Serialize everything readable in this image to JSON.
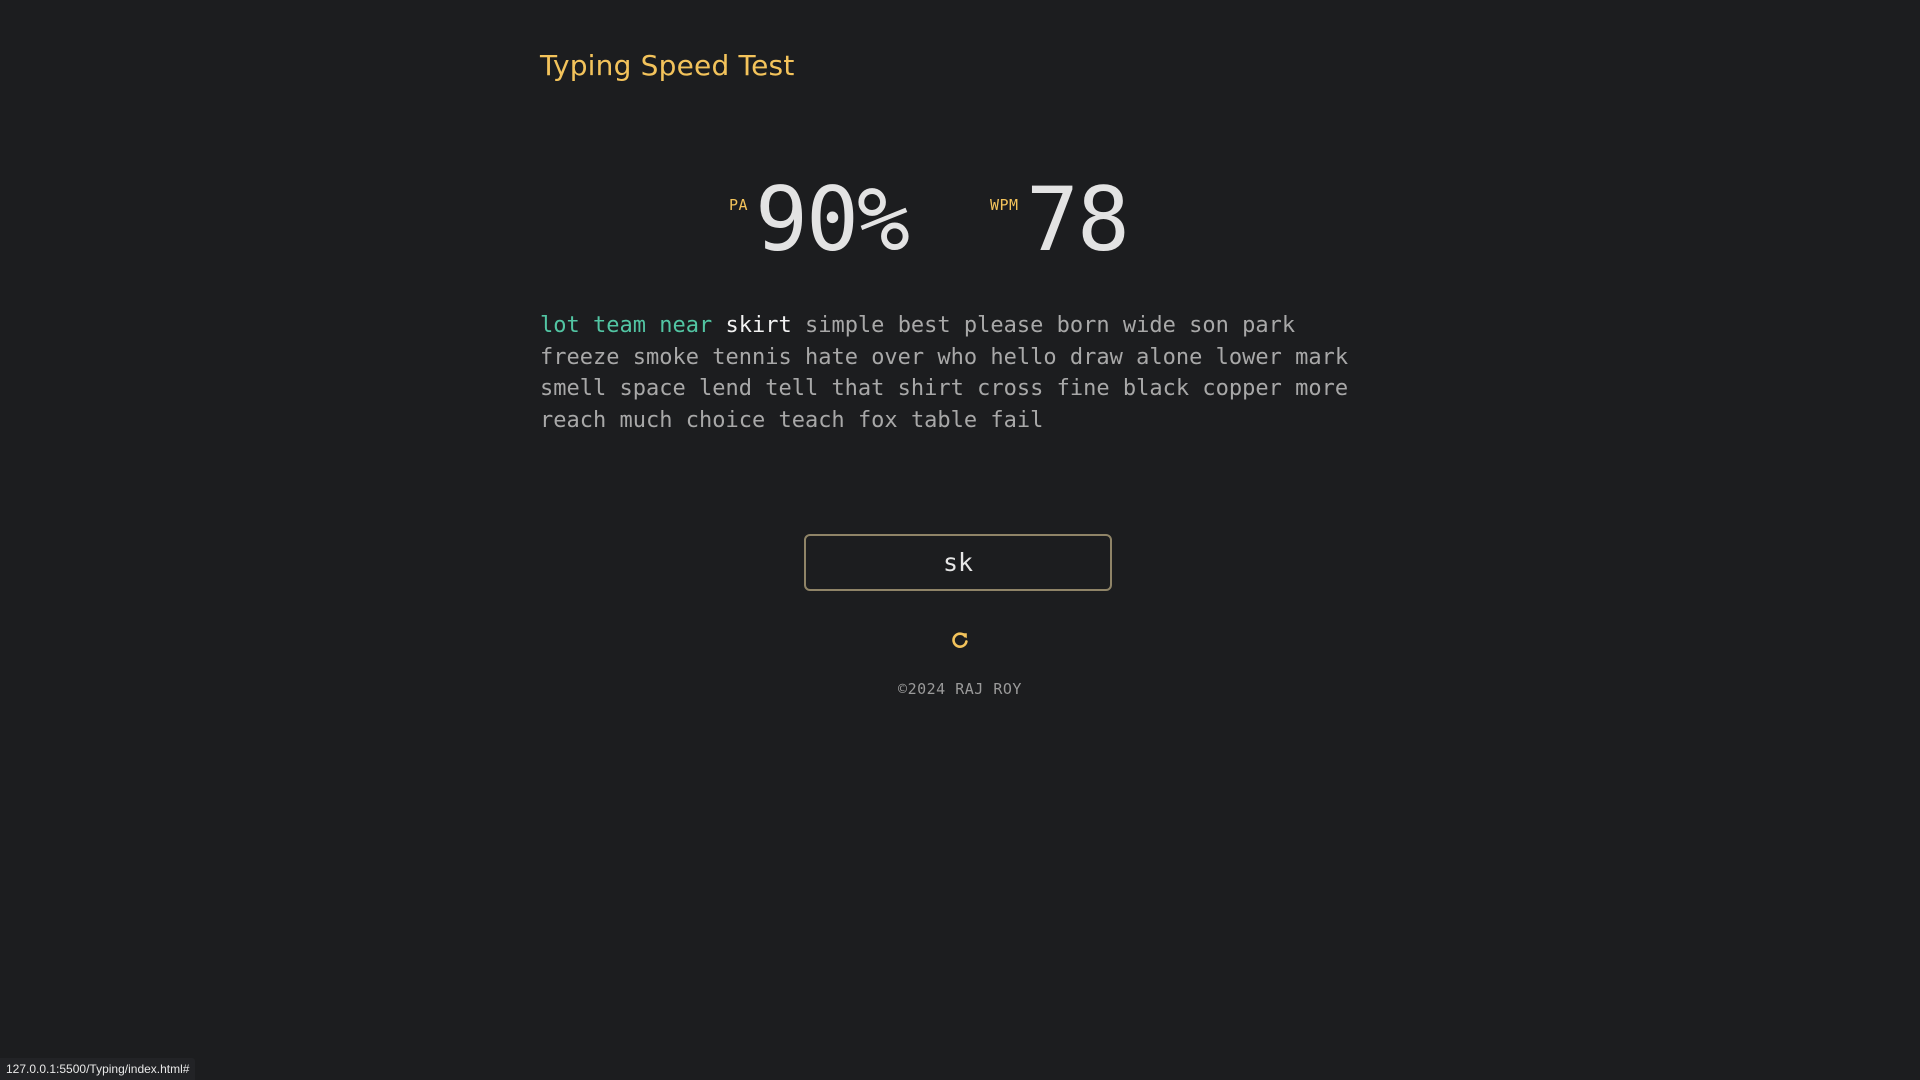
{
  "app": {
    "title": "Typing Speed Test",
    "accent_color": "#f3c35b",
    "correct_color": "#52c5a3",
    "background_color": "#1c1d1f"
  },
  "stats": {
    "accuracy_label": "PA",
    "accuracy_value": "90%",
    "wpm_label": "WPM",
    "wpm_value": "78"
  },
  "words": [
    {
      "text": "lot",
      "state": "correct"
    },
    {
      "text": "team",
      "state": "correct"
    },
    {
      "text": "near",
      "state": "correct"
    },
    {
      "text": "skirt",
      "state": "current"
    },
    {
      "text": "simple",
      "state": "pending"
    },
    {
      "text": "best",
      "state": "pending"
    },
    {
      "text": "please",
      "state": "pending"
    },
    {
      "text": "born",
      "state": "pending"
    },
    {
      "text": "wide",
      "state": "pending"
    },
    {
      "text": "son",
      "state": "pending"
    },
    {
      "text": "park",
      "state": "pending"
    },
    {
      "text": "freeze",
      "state": "pending"
    },
    {
      "text": "smoke",
      "state": "pending"
    },
    {
      "text": "tennis",
      "state": "pending"
    },
    {
      "text": "hate",
      "state": "pending"
    },
    {
      "text": "over",
      "state": "pending"
    },
    {
      "text": "who",
      "state": "pending"
    },
    {
      "text": "hello",
      "state": "pending"
    },
    {
      "text": "draw",
      "state": "pending"
    },
    {
      "text": "alone",
      "state": "pending"
    },
    {
      "text": "lower",
      "state": "pending"
    },
    {
      "text": "mark",
      "state": "pending"
    },
    {
      "text": "smell",
      "state": "pending"
    },
    {
      "text": "space",
      "state": "pending"
    },
    {
      "text": "lend",
      "state": "pending"
    },
    {
      "text": "tell",
      "state": "pending"
    },
    {
      "text": "that",
      "state": "pending"
    },
    {
      "text": "shirt",
      "state": "pending"
    },
    {
      "text": "cross",
      "state": "pending"
    },
    {
      "text": "fine",
      "state": "pending"
    },
    {
      "text": "black",
      "state": "pending"
    },
    {
      "text": "copper",
      "state": "pending"
    },
    {
      "text": "more",
      "state": "pending"
    },
    {
      "text": "reach",
      "state": "pending"
    },
    {
      "text": "much",
      "state": "pending"
    },
    {
      "text": "choice",
      "state": "pending"
    },
    {
      "text": "teach",
      "state": "pending"
    },
    {
      "text": "fox",
      "state": "pending"
    },
    {
      "text": "table",
      "state": "pending"
    },
    {
      "text": "fail",
      "state": "pending"
    }
  ],
  "input": {
    "value": "sk"
  },
  "reset": {
    "icon": "refresh-icon"
  },
  "footer": {
    "text": "©2024 RAJ ROY"
  },
  "status_bar": {
    "url": "127.0.0.1:5500/Typing/index.html#"
  }
}
